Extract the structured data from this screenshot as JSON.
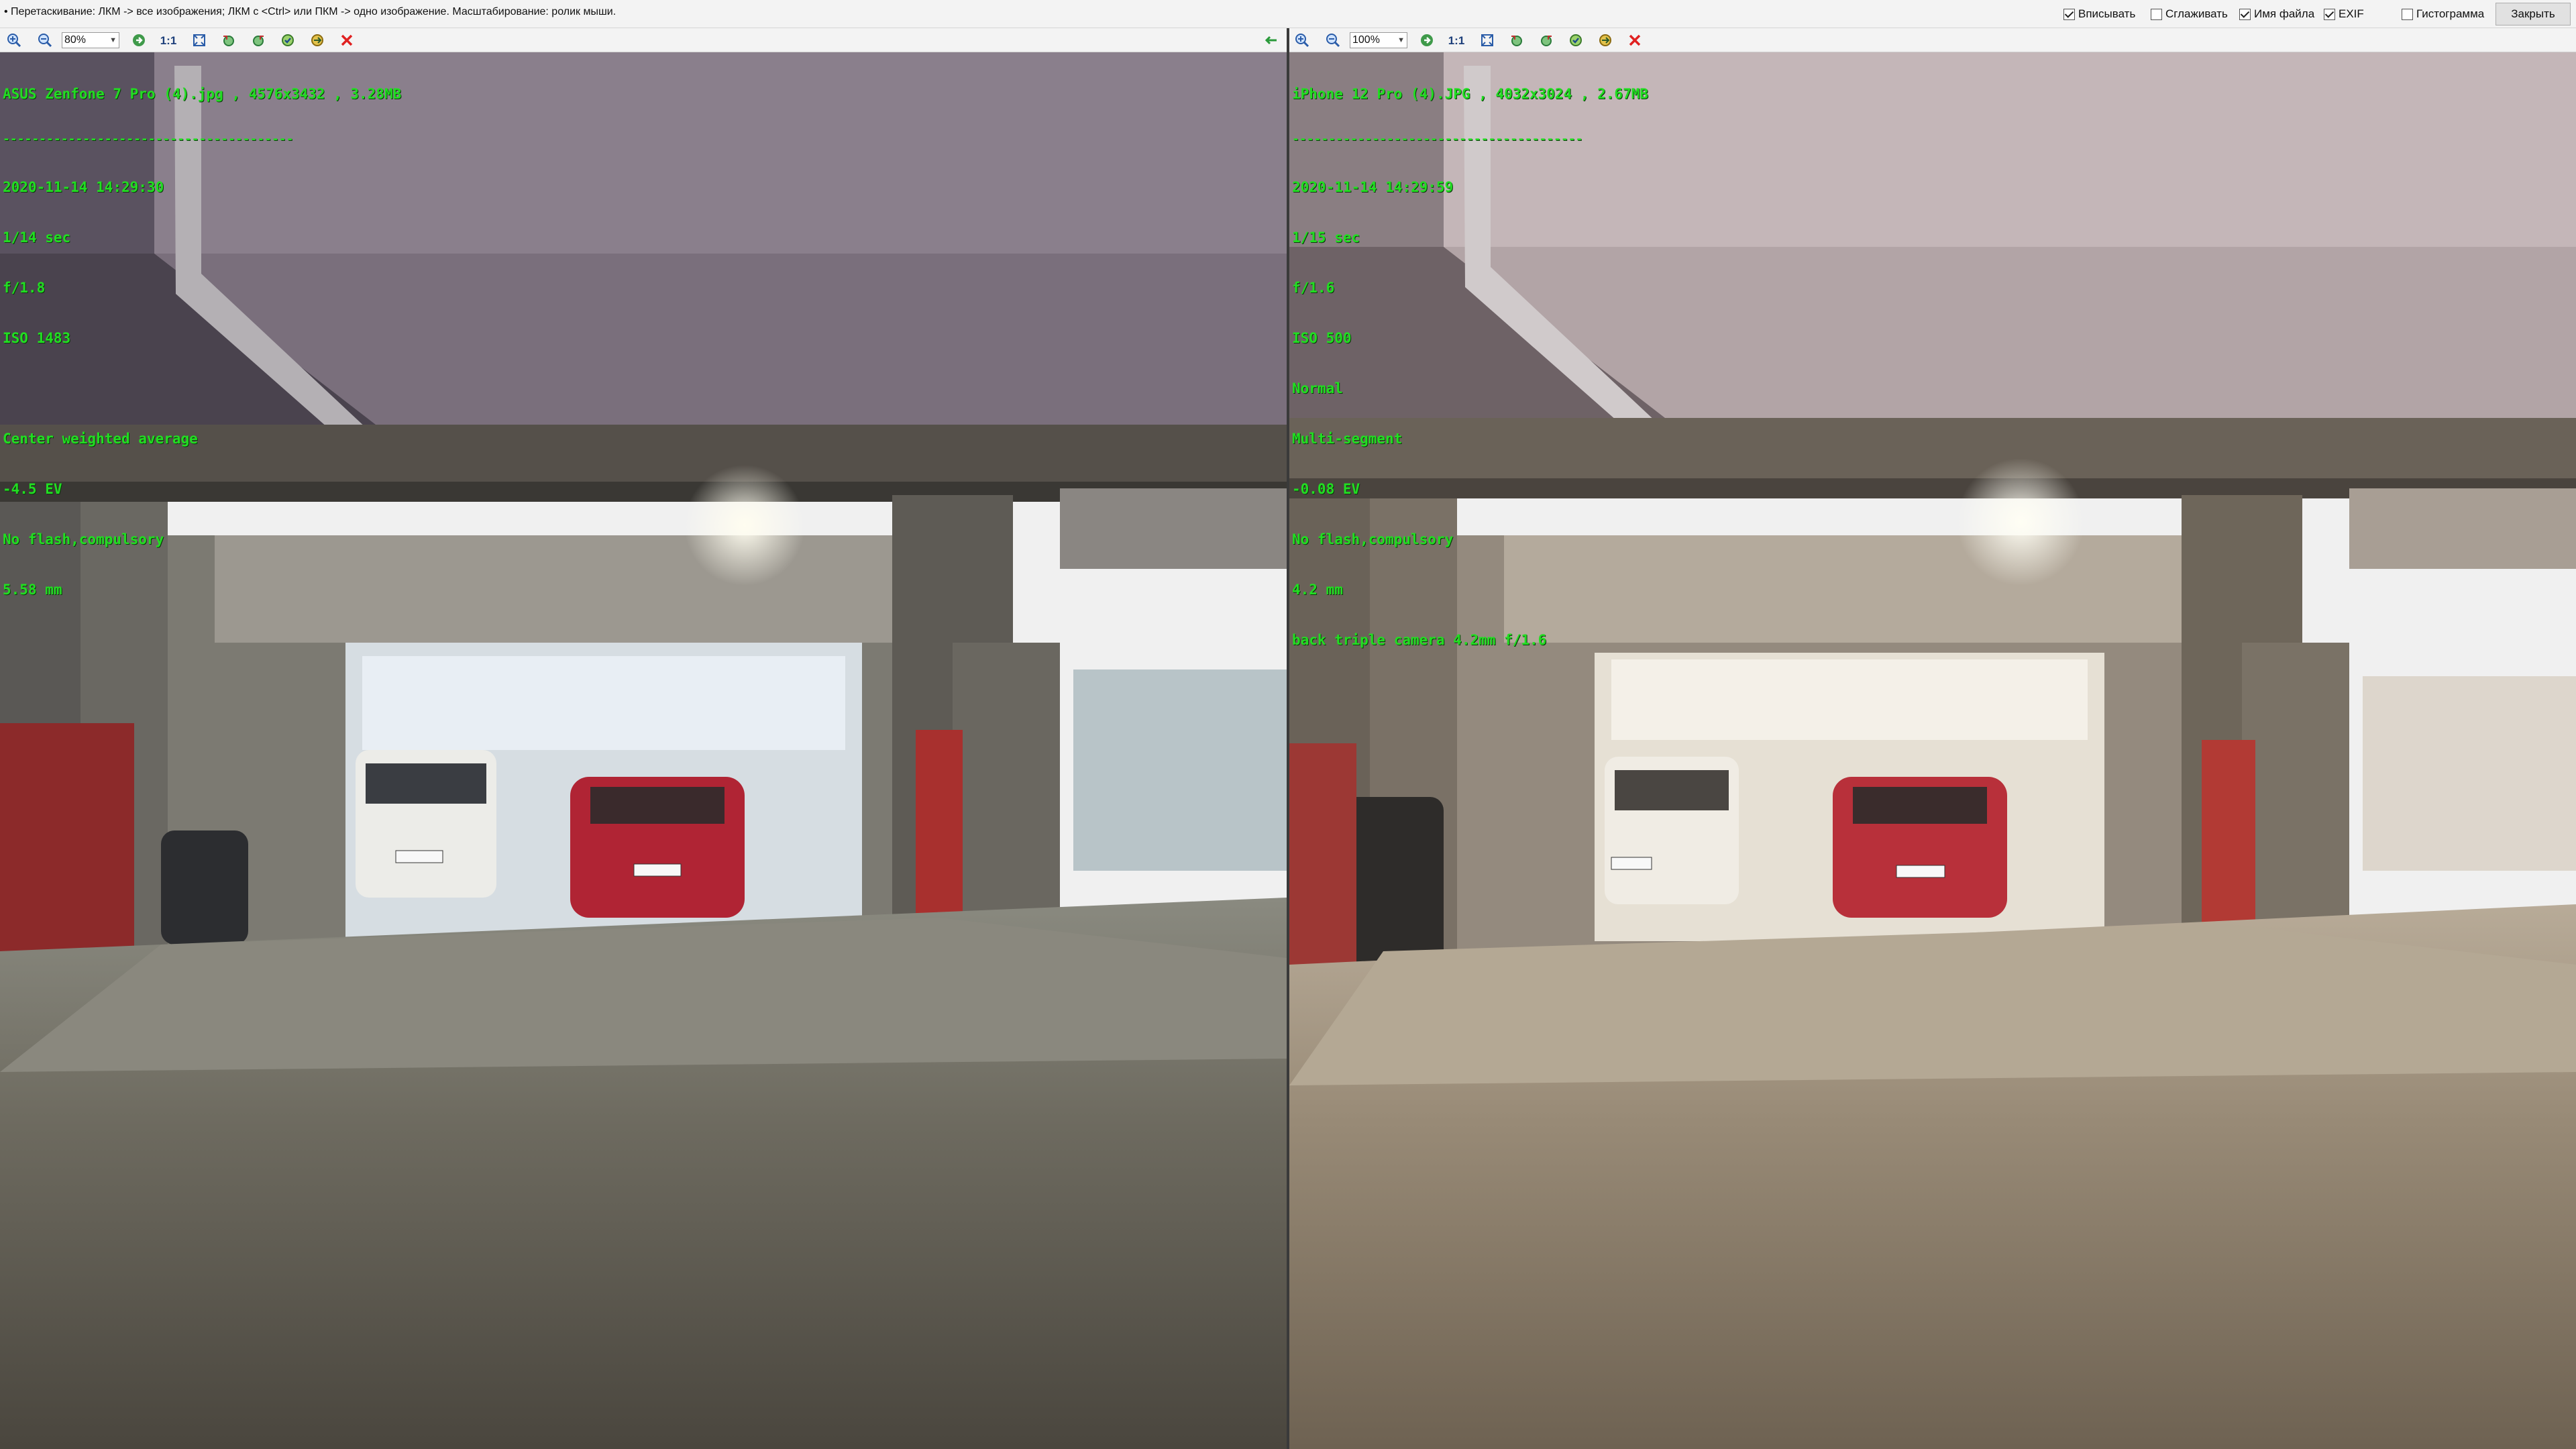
{
  "hint": "• Перетаскивание: ЛКМ -> все изображения; ЛКМ с <Ctrl> или ПКМ -> одно изображение. Масштабирование: ролик мыши.",
  "options": [
    {
      "label": "Вписывать",
      "checked": true
    },
    {
      "label": "Сглаживать",
      "checked": false
    },
    {
      "label": "Имя файла",
      "checked": true
    },
    {
      "label": "EXIF",
      "checked": true
    },
    {
      "label": "Гистограмма",
      "checked": false
    }
  ],
  "close_label": "Закрыть",
  "left": {
    "zoom": "80%",
    "one_to_one": "1:1",
    "header": "ASUS Zenfone 7 Pro (4).jpg , 4576x3432 , 3.28MB",
    "separator": "----------------------------------------",
    "exif": [
      "2020-11-14 14:29:30",
      "1/14 sec",
      "f/1.8",
      "ISO 1483",
      "",
      "Center weighted average",
      "-4.5 EV",
      "No flash,compulsory",
      "5.58 mm"
    ]
  },
  "right": {
    "zoom": "100%",
    "one_to_one": "1:1",
    "header": "iPhone 12 Pro (4).JPG , 4032x3024 , 2.67MB",
    "separator": "----------------------------------------",
    "exif": [
      "2020-11-14 14:29:59",
      "1/15 sec",
      "f/1.6",
      "ISO 500",
      "Normal",
      "Multi-segment",
      "-0.08 EV",
      "No flash,compulsory",
      "4.2 mm",
      "back triple camera 4.2mm f/1.6"
    ]
  },
  "icons": [
    "zoom-in-icon",
    "zoom-out-icon",
    "next-icon",
    "fit-icon",
    "rotate-left-icon",
    "rotate-right-icon",
    "save-icon",
    "copy-icon",
    "delete-icon",
    "sync-arrow-icon"
  ],
  "colors": {
    "exif_text": "#22dd22",
    "delete": "#e02020",
    "toolbar_icon": "#2a8a3a"
  }
}
